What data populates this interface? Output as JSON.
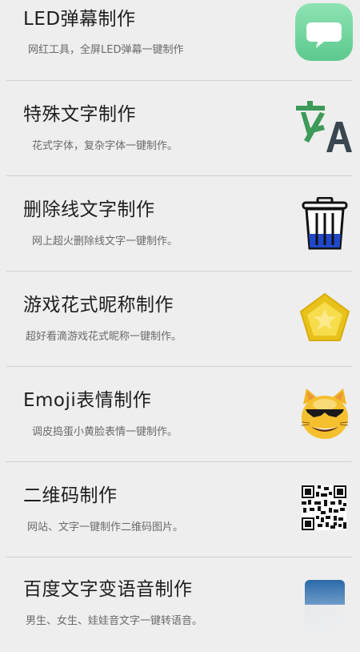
{
  "items": [
    {
      "title": "LED弹幕制作",
      "desc": "网红工具，全屏LED弹幕一键制作",
      "icon": "chat-bubble-icon"
    },
    {
      "title": "特殊文字制作",
      "desc": "花式字体，复杂字体一键制作。",
      "icon": "translate-icon"
    },
    {
      "title": "删除线文字制作",
      "desc": "网上超火删除线文字一键制作。",
      "icon": "trash-can-icon"
    },
    {
      "title": "游戏花式昵称制作",
      "desc": "超好看滴游戏花式昵称一键制作。",
      "icon": "pentagon-star-icon"
    },
    {
      "title": "Emoji表情制作",
      "desc": "调皮捣蛋小黄脸表情一键制作。",
      "icon": "cat-sunglasses-icon"
    },
    {
      "title": "二维码制作",
      "desc": "网站、文字一键制作二维码图片。",
      "icon": "qr-code-icon"
    },
    {
      "title": "百度文字变语音制作",
      "desc": "男生、女生、娃娃音文字一键转语音。",
      "icon": "audio-bar-icon"
    }
  ],
  "colors": {
    "background": "#eeeeee",
    "divider": "#cfcfcf",
    "title": "#1e1e1e",
    "desc": "#6a6a6a"
  }
}
